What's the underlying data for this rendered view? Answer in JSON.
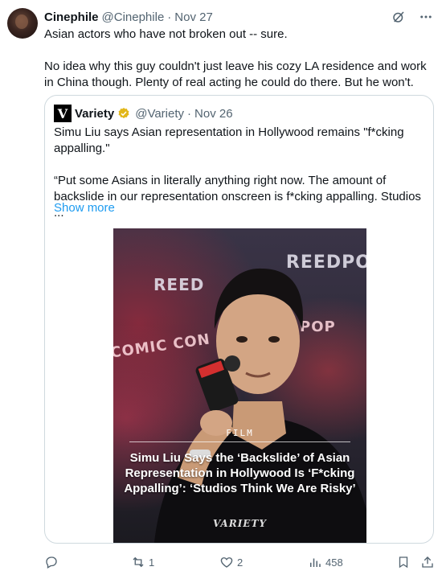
{
  "tweet": {
    "name": "Cinephile",
    "handle": "@Cinephile",
    "separator": "·",
    "date": "Nov 27",
    "lines": [
      "Asian actors who have not broken out -- sure.",
      "No idea why this guy couldn't just leave his cozy LA residence and work in China though. Plenty of real acting he could do there. But he won't."
    ]
  },
  "quote": {
    "logo_letter": "V",
    "name": "Variety",
    "handle": "@Variety",
    "separator": "·",
    "date": "Nov 26",
    "line1": "Simu Liu says Asian representation in Hollywood remains \"f*cking appalling.\"",
    "line2": "“Put some Asians in literally anything right now. The amount of backslide in our representation onscreen is f*cking appalling. Studios ...",
    "show_more": "Show more",
    "media": {
      "wall_text_1": "REEDPO",
      "wall_text_2": "REED",
      "wall_text_3": "COMIC CON",
      "wall_text_4": "POP",
      "tag": "FILM",
      "headline": "Simu Liu Says the ‘Backslide’ of Asian Representation in Hollywood Is ‘F*cking Appalling’: ‘Studios Think We Are Risky’",
      "brand": "VARIETY"
    }
  },
  "actions": {
    "reply_count": "",
    "retweet_count": "1",
    "like_count": "2",
    "views_count": "458"
  },
  "icons": {
    "grok": "grok-icon",
    "more": "more-icon",
    "verified": "verified-badge-icon",
    "reply": "reply-icon",
    "retweet": "retweet-icon",
    "like": "heart-icon",
    "views": "views-icon",
    "bookmark": "bookmark-icon",
    "share": "share-icon"
  },
  "colors": {
    "link": "#1d9bf0",
    "secondary_text": "#536471",
    "verified_gold": "#e2b719"
  }
}
